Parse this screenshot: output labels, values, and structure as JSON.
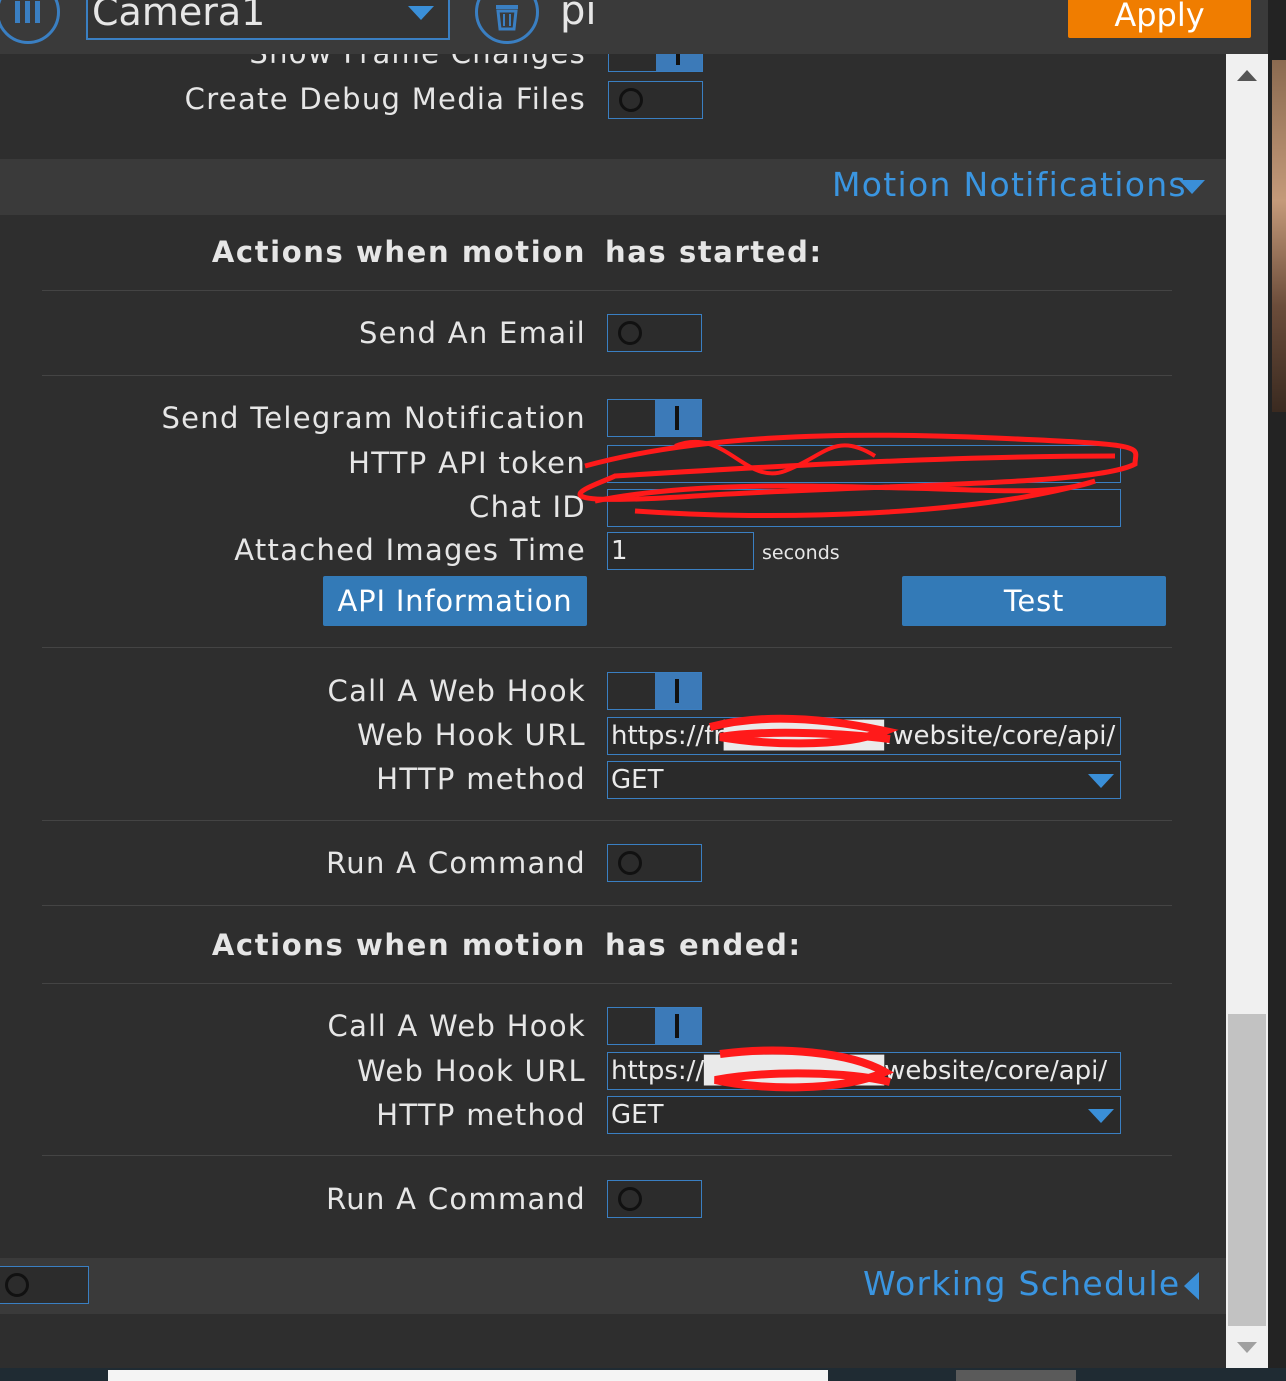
{
  "header": {
    "camera_select_value": "Camera1",
    "device_name": "pi",
    "apply_label": "Apply"
  },
  "debug": {
    "show_frame_changes_label": "Show Frame Changes",
    "show_frame_changes_on": true,
    "create_debug_media_label": "Create Debug Media Files",
    "create_debug_media_on": false
  },
  "motion_notifications": {
    "title": "Motion Notifications",
    "started_heading_left": "Actions when motion",
    "started_heading_right": "has started:",
    "send_email_label": "Send An Email",
    "send_email_on": false,
    "telegram_label": "Send Telegram Notification",
    "telegram_on": true,
    "api_token_label": "HTTP API token",
    "chat_id_label": "Chat ID",
    "attached_images_label": "Attached Images Time",
    "attached_images_value": "1",
    "attached_images_unit": "seconds",
    "api_info_button": "API Information",
    "test_button": "Test",
    "started_webhook_label": "Call A Web Hook",
    "started_webhook_on": true,
    "started_webhook_url_label": "Web Hook URL",
    "started_webhook_url": "https://fr████████.website/core/api/",
    "started_http_method_label": "HTTP method",
    "started_http_method": "GET",
    "started_command_label": "Run A Command",
    "started_command_on": false,
    "ended_heading_left": "Actions when motion",
    "ended_heading_right": "has ended:",
    "ended_webhook_label": "Call A Web Hook",
    "ended_webhook_on": true,
    "ended_webhook_url_label": "Web Hook URL",
    "ended_webhook_url": "https://█████████website/core/api/",
    "ended_http_method_label": "HTTP method",
    "ended_http_method": "GET",
    "ended_command_label": "Run A Command",
    "ended_command_on": false
  },
  "working_schedule": {
    "title": "Working Schedule",
    "enabled": false
  },
  "colors": {
    "accent": "#3a7fc2",
    "apply": "#f07d00",
    "redaction": "#ff1a1a"
  }
}
